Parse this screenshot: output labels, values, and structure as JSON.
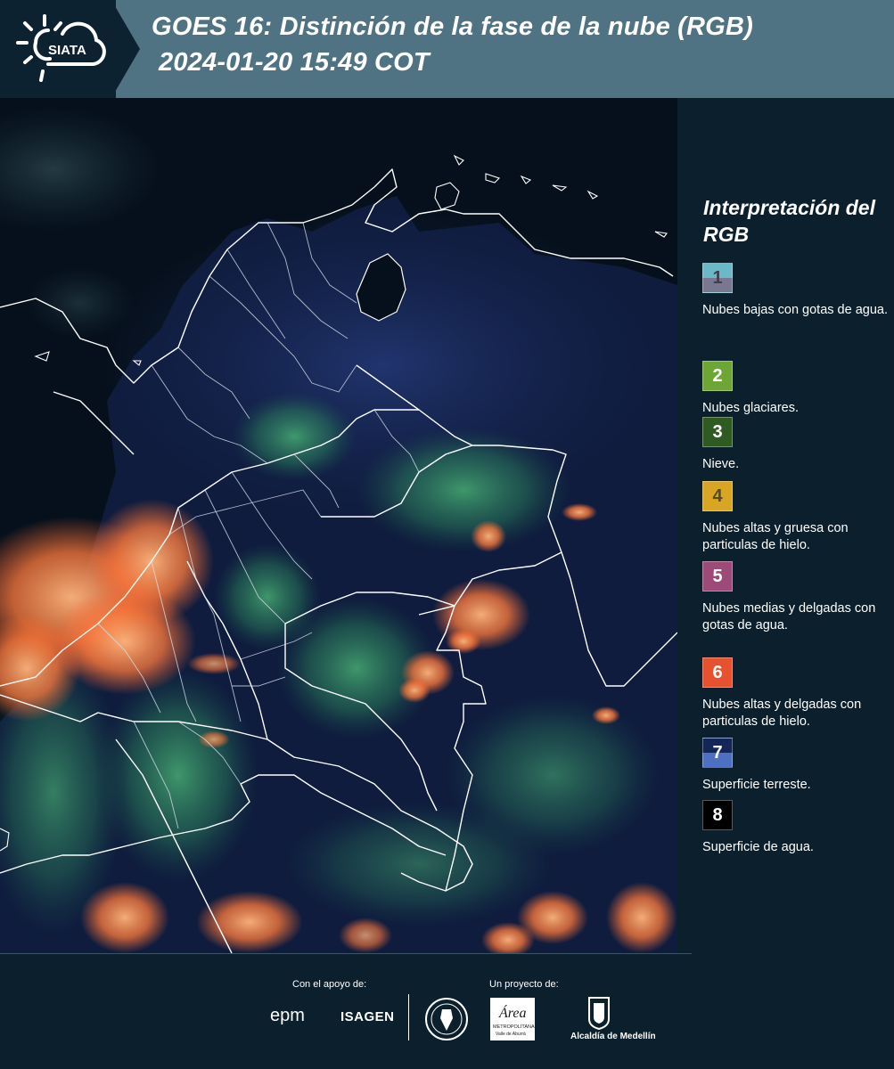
{
  "header": {
    "logo_text": "SIATA",
    "title_line1": "GOES 16: Distinción de la fase de la nube (RGB)",
    "title_line2": "2024-01-20 15:49 COT"
  },
  "legend": {
    "title": "Interpretación del RGB",
    "items": [
      {
        "number": "1",
        "label": "Nubes bajas con gotas de agua.",
        "color_top": "#6cb8c6",
        "color_bottom": "#7a7890",
        "text_color": "#3e3e4e"
      },
      {
        "number": "2",
        "label": "Nubes glaciares.",
        "color_top": "#6ea636",
        "color_bottom": "#6ea636",
        "text_color": "#ffffff"
      },
      {
        "number": "3",
        "label": "Nieve.",
        "color_top": "#2f5a22",
        "color_bottom": "#2f5a22",
        "text_color": "#ffffff"
      },
      {
        "number": "4",
        "label": "Nubes altas y gruesa con particulas de hielo.",
        "color_top": "#d9a623",
        "color_bottom": "#d9a623",
        "text_color": "#5a4a20"
      },
      {
        "number": "5",
        "label": "Nubes medias y delgadas con gotas de agua.",
        "color_top": "#9c4a78",
        "color_bottom": "#9c4a78",
        "text_color": "#ffffff"
      },
      {
        "number": "6",
        "label": "Nubes altas y delgadas con particulas de hielo.",
        "color_top": "#e8512f",
        "color_bottom": "#e8512f",
        "text_color": "#ffffff"
      },
      {
        "number": "7",
        "label": "Superficie terreste.",
        "color_top": "#142656",
        "color_bottom": "#4d70c2",
        "text_color": "#ffffff"
      },
      {
        "number": "8",
        "label": "Superficie de agua.",
        "color_top": "#000000",
        "color_bottom": "#000000",
        "text_color": "#ffffff"
      }
    ]
  },
  "footer": {
    "support_label": "Con el apoyo de:",
    "project_label": "Un proyecto de:",
    "sponsor1": "epm",
    "sponsor2": "ISAGEN",
    "partner_area_line1": "Área",
    "partner_area_line2": "METROPOLITANA",
    "partner_area_line3": "Valle de Aburrá",
    "partner_alcaldia": "Alcaldía de Medellín"
  }
}
